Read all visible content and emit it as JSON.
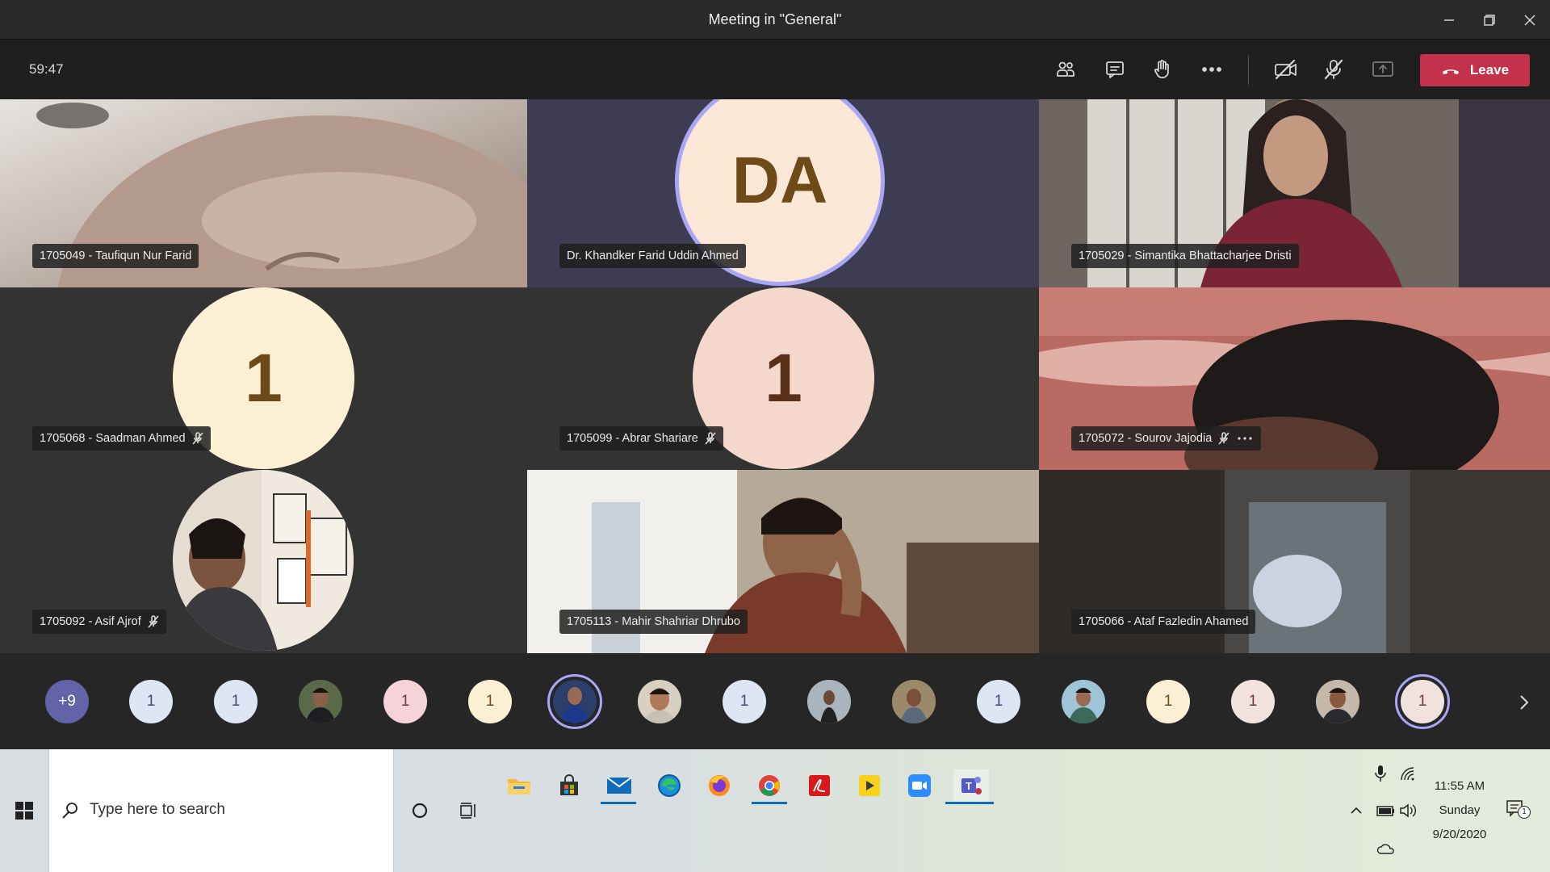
{
  "window": {
    "title": "Meeting in \"General\""
  },
  "toolbar": {
    "timer": "59:47",
    "leave_label": "Leave"
  },
  "tiles": [
    {
      "name": "1705049 - Taufiqun Nur Farid",
      "muted": false,
      "bg": "#b9b5ae"
    },
    {
      "name": "Dr. Khandker Farid Uddin Ahmed",
      "muted": false,
      "initials": "DA",
      "bg": "#3d3b52"
    },
    {
      "name": "1705029 - Simantika Bhattacharjee Dristi",
      "muted": false,
      "bg": "#6a4a52"
    },
    {
      "name": "1705068 - Saadman Ahmed",
      "muted": true,
      "initials": "1",
      "bg": "#333333"
    },
    {
      "name": "1705099 - Abrar Shariare",
      "muted": true,
      "initials": "1",
      "bg": "#333333"
    },
    {
      "name": "1705072 - Sourov Jajodia",
      "muted": true,
      "more": true,
      "bg": "#a85a52"
    },
    {
      "name": "1705092 - Asif Ajrof",
      "muted": true,
      "bg": "#333333"
    },
    {
      "name": "1705113 - Mahir Shahriar Dhrubo",
      "muted": false,
      "bg": "#8a8070"
    },
    {
      "name": "1705066 - Ataf Fazledin Ahamed",
      "muted": false,
      "bg": "#2d2a28"
    }
  ],
  "strip": {
    "overflow": "+9",
    "avatars": [
      "1",
      "1",
      "",
      "1",
      "1",
      "",
      "",
      "1",
      "",
      "",
      "1",
      "",
      "1",
      "1",
      "",
      "1"
    ]
  },
  "taskbar": {
    "search_placeholder": "Type here to search",
    "time": "11:55 AM",
    "day": "Sunday",
    "date": "9/20/2020",
    "notifications": "1"
  }
}
